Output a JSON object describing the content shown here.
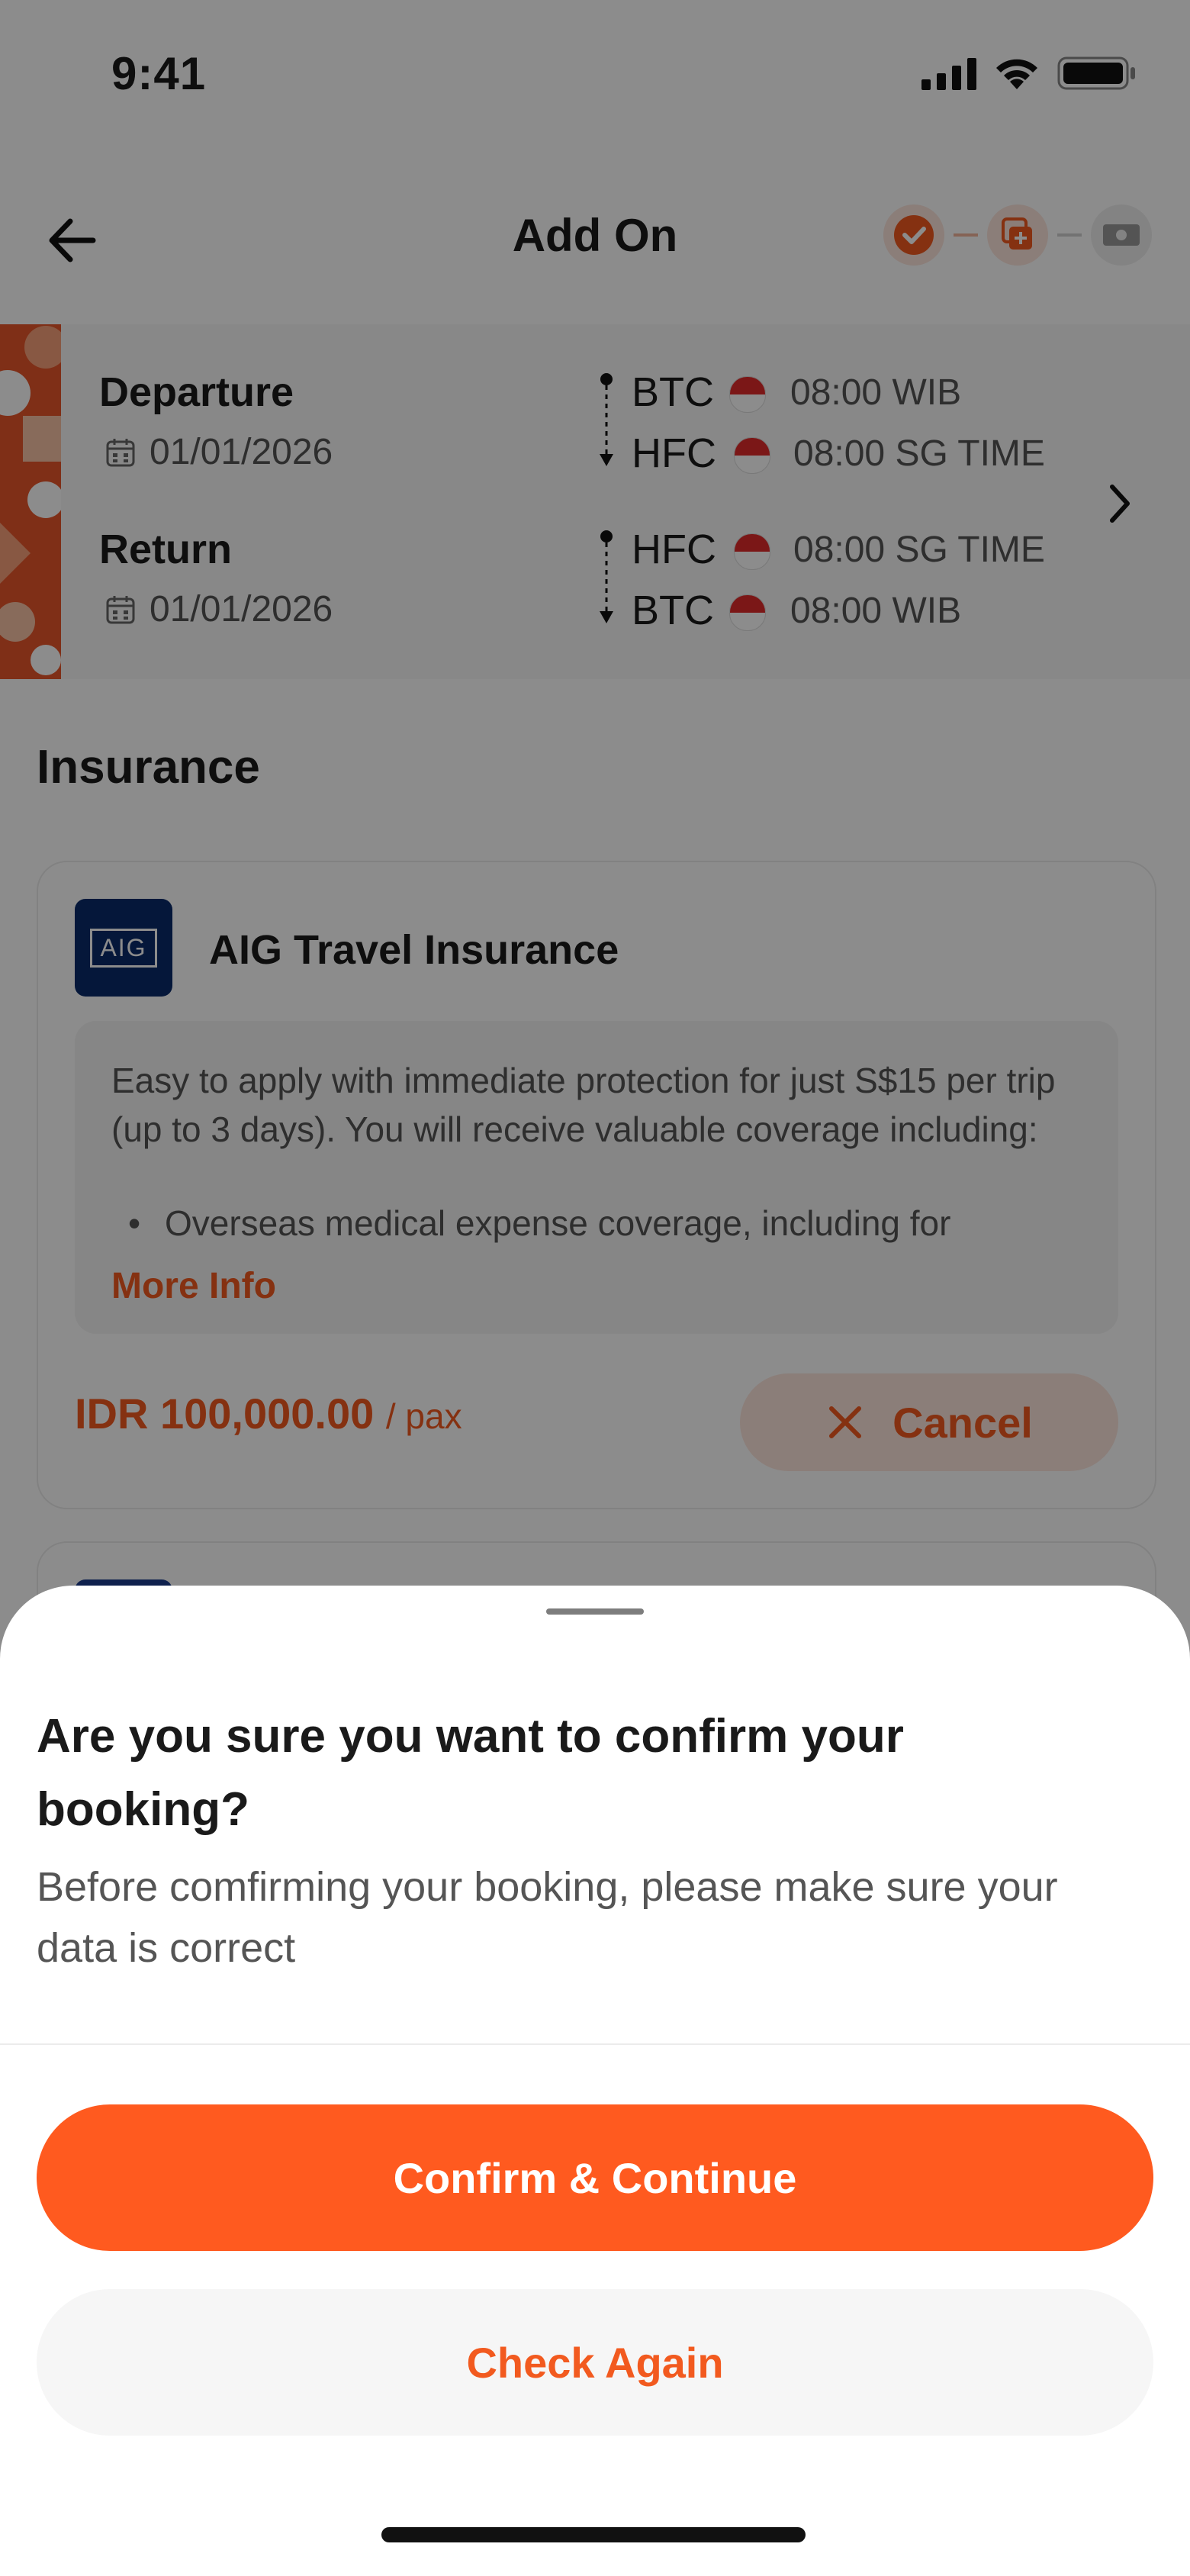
{
  "status_bar": {
    "time": "9:41"
  },
  "header": {
    "title": "Add On"
  },
  "itinerary": {
    "departure": {
      "label": "Departure",
      "date": "01/01/2026",
      "from_code": "BTC",
      "from_time": "08:00 WIB",
      "to_code": "HFC",
      "to_time": "08:00 SG TIME"
    },
    "return": {
      "label": "Return",
      "date": "01/01/2026",
      "from_code": "HFC",
      "from_time": "08:00 SG TIME",
      "to_code": "BTC",
      "to_time": "08:00 WIB"
    }
  },
  "insurance": {
    "section_title": "Insurance",
    "provider_logo_text": "AIG",
    "name": "AIG Travel Insurance",
    "description": "Easy to apply with immediate protection for just S$15 per trip (up to 3 days). You will receive valuable coverage including:",
    "bullet": "Overseas medical expense coverage, including for",
    "more_info": "More Info",
    "price": "IDR 100,000.00",
    "price_unit": "/ pax",
    "cancel_label": "Cancel"
  },
  "confirm_sheet": {
    "title": "Are you sure you want to confirm your booking?",
    "message": "Before comfirming your booking, please make sure your data is correct",
    "confirm_label": "Confirm & Continue",
    "check_label": "Check Again"
  },
  "colors": {
    "accent": "#ff5a1f",
    "accent_text": "#f25a1f",
    "cancel_bg": "#fde5dc",
    "aig_blue": "#0a2a6b"
  },
  "icons": {
    "back": "arrow-left-icon",
    "step1": "check-circle-icon",
    "step2": "add-on-icon",
    "step3": "payment-icon",
    "calendar": "calendar-icon",
    "chevron": "chevron-right-icon",
    "cancel": "close-icon"
  }
}
